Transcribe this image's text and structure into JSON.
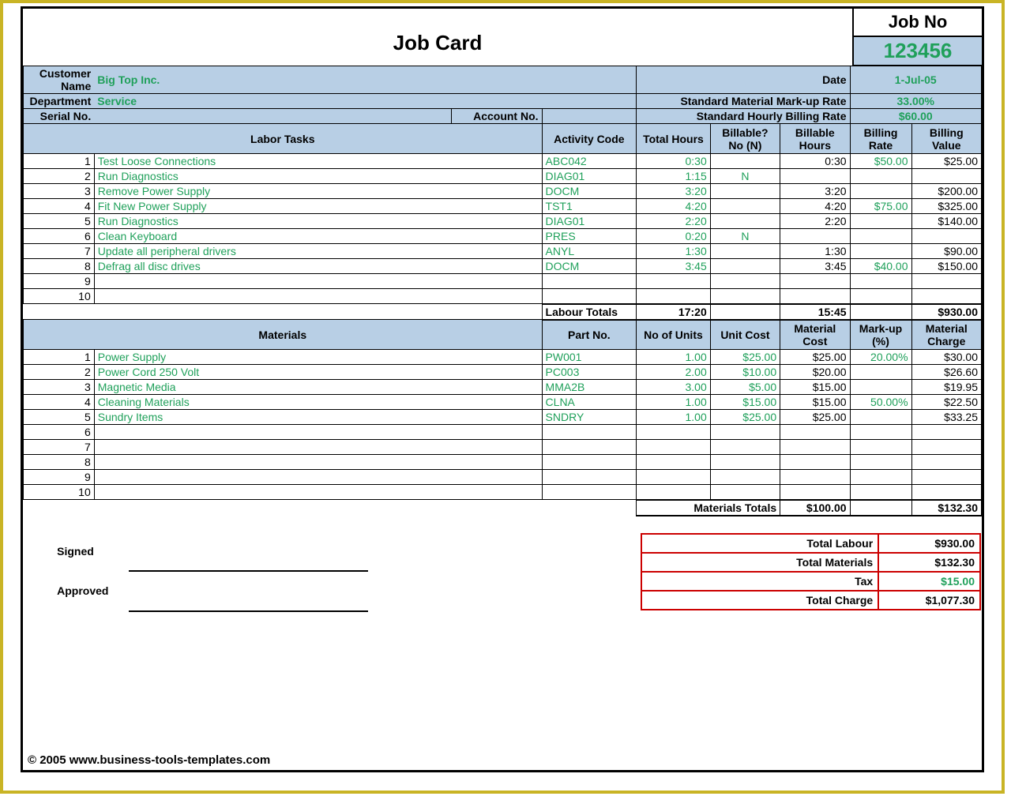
{
  "title": "Job Card",
  "jobno_label": "Job No",
  "jobno_value": "123456",
  "info": {
    "customer_name_label": "Customer Name",
    "customer_name": "Big Top Inc.",
    "date_label": "Date",
    "date": "1-Jul-05",
    "department_label": "Department",
    "department": "Service",
    "markup_label": "Standard Material Mark-up Rate",
    "markup": "33.00%",
    "serial_label": "Serial No.",
    "account_label": "Account No.",
    "hourly_label": "Standard Hourly Billing Rate",
    "hourly": "$60.00"
  },
  "labor": {
    "header_tasks": "Labor Tasks",
    "header_code": "Activity Code",
    "header_hours": "Total Hours",
    "header_billable_q": "Billable? No (N)",
    "header_billable_hours": "Billable Hours",
    "header_rate": "Billing Rate",
    "header_value": "Billing Value",
    "rows": [
      {
        "n": "1",
        "task": "Test Loose Connections",
        "code": "ABC042",
        "hours": "0:30",
        "billable": "",
        "bhours": "0:30",
        "rate": "$50.00",
        "value": "$25.00"
      },
      {
        "n": "2",
        "task": "Run Diagnostics",
        "code": "DIAG01",
        "hours": "1:15",
        "billable": "N",
        "bhours": "",
        "rate": "",
        "value": ""
      },
      {
        "n": "3",
        "task": "Remove Power Supply",
        "code": "DOCM",
        "hours": "3:20",
        "billable": "",
        "bhours": "3:20",
        "rate": "",
        "value": "$200.00"
      },
      {
        "n": "4",
        "task": "Fit New Power Supply",
        "code": "TST1",
        "hours": "4:20",
        "billable": "",
        "bhours": "4:20",
        "rate": "$75.00",
        "value": "$325.00"
      },
      {
        "n": "5",
        "task": "Run Diagnostics",
        "code": "DIAG01",
        "hours": "2:20",
        "billable": "",
        "bhours": "2:20",
        "rate": "",
        "value": "$140.00"
      },
      {
        "n": "6",
        "task": "Clean Keyboard",
        "code": "PRES",
        "hours": "0:20",
        "billable": "N",
        "bhours": "",
        "rate": "",
        "value": ""
      },
      {
        "n": "7",
        "task": "Update all peripheral drivers",
        "code": "ANYL",
        "hours": "1:30",
        "billable": "",
        "bhours": "1:30",
        "rate": "",
        "value": "$90.00"
      },
      {
        "n": "8",
        "task": "Defrag all disc drives",
        "code": "DOCM",
        "hours": "3:45",
        "billable": "",
        "bhours": "3:45",
        "rate": "$40.00",
        "value": "$150.00"
      },
      {
        "n": "9",
        "task": "",
        "code": "",
        "hours": "",
        "billable": "",
        "bhours": "",
        "rate": "",
        "value": ""
      },
      {
        "n": "10",
        "task": "",
        "code": "",
        "hours": "",
        "billable": "",
        "bhours": "",
        "rate": "",
        "value": ""
      }
    ],
    "totals_label": "Labour Totals",
    "totals_hours": "17:20",
    "totals_bhours": "15:45",
    "totals_value": "$930.00"
  },
  "materials": {
    "header": "Materials",
    "header_part": "Part No.",
    "header_units": "No of Units",
    "header_cost": "Unit Cost",
    "header_matcost": "Material Cost",
    "header_markup": "Mark-up (%)",
    "header_charge": "Material Charge",
    "rows": [
      {
        "n": "1",
        "mat": "Power Supply",
        "part": "PW001",
        "units": "1.00",
        "cost": "$25.00",
        "matcost": "$25.00",
        "markup": "20.00%",
        "charge": "$30.00"
      },
      {
        "n": "2",
        "mat": "Power Cord 250 Volt",
        "part": "PC003",
        "units": "2.00",
        "cost": "$10.00",
        "matcost": "$20.00",
        "markup": "",
        "charge": "$26.60"
      },
      {
        "n": "3",
        "mat": "Magnetic Media",
        "part": "MMA2B",
        "units": "3.00",
        "cost": "$5.00",
        "matcost": "$15.00",
        "markup": "",
        "charge": "$19.95"
      },
      {
        "n": "4",
        "mat": "Cleaning Materials",
        "part": "CLNA",
        "units": "1.00",
        "cost": "$15.00",
        "matcost": "$15.00",
        "markup": "50.00%",
        "charge": "$22.50"
      },
      {
        "n": "5",
        "mat": "Sundry Items",
        "part": "SNDRY",
        "units": "1.00",
        "cost": "$25.00",
        "matcost": "$25.00",
        "markup": "",
        "charge": "$33.25"
      },
      {
        "n": "6",
        "mat": "",
        "part": "",
        "units": "",
        "cost": "",
        "matcost": "",
        "markup": "",
        "charge": ""
      },
      {
        "n": "7",
        "mat": "",
        "part": "",
        "units": "",
        "cost": "",
        "matcost": "",
        "markup": "",
        "charge": ""
      },
      {
        "n": "8",
        "mat": "",
        "part": "",
        "units": "",
        "cost": "",
        "matcost": "",
        "markup": "",
        "charge": ""
      },
      {
        "n": "9",
        "mat": "",
        "part": "",
        "units": "",
        "cost": "",
        "matcost": "",
        "markup": "",
        "charge": ""
      },
      {
        "n": "10",
        "mat": "",
        "part": "",
        "units": "",
        "cost": "",
        "matcost": "",
        "markup": "",
        "charge": ""
      }
    ],
    "totals_label": "Materials Totals",
    "totals_cost": "$100.00",
    "totals_charge": "$132.30"
  },
  "sign": {
    "signed": "Signed",
    "approved": "Approved"
  },
  "totals": {
    "labour_label": "Total Labour",
    "labour": "$930.00",
    "materials_label": "Total Materials",
    "materials": "$132.30",
    "tax_label": "Tax",
    "tax": "$15.00",
    "charge_label": "Total Charge",
    "charge": "$1,077.30"
  },
  "copyright": "© 2005 www.business-tools-templates.com"
}
